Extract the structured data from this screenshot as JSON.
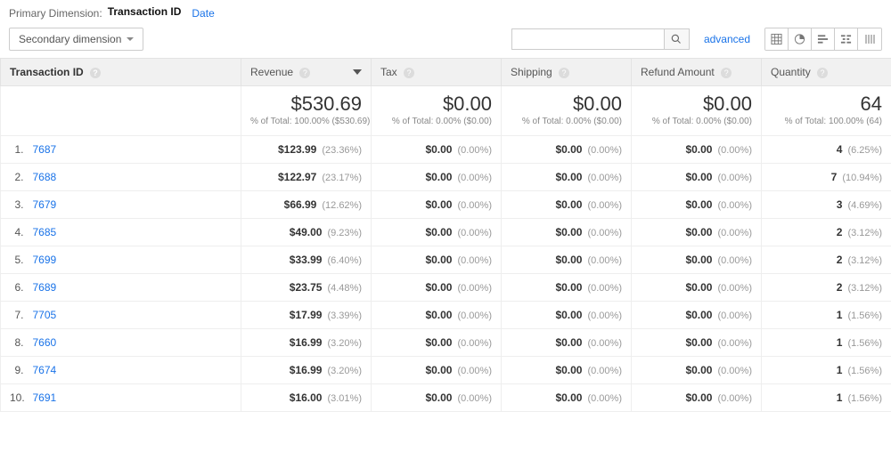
{
  "primary_dimension": {
    "label": "Primary Dimension:",
    "active": "Transaction ID",
    "other": "Date"
  },
  "secondary_dimension": {
    "label": "Secondary dimension"
  },
  "advanced_link": "advanced",
  "columns": {
    "transaction_id": "Transaction ID",
    "revenue": "Revenue",
    "tax": "Tax",
    "shipping": "Shipping",
    "refund": "Refund Amount",
    "quantity": "Quantity"
  },
  "totals": {
    "revenue_val": "$530.69",
    "revenue_sub": "% of Total: 100.00% ($530.69)",
    "tax_val": "$0.00",
    "tax_sub": "% of Total: 0.00% ($0.00)",
    "shipping_val": "$0.00",
    "shipping_sub": "% of Total: 0.00% ($0.00)",
    "refund_val": "$0.00",
    "refund_sub": "% of Total: 0.00% ($0.00)",
    "quantity_val": "64",
    "quantity_sub": "% of Total: 100.00% (64)"
  },
  "rows": [
    {
      "idx": "1.",
      "tid": "7687",
      "rev_v": "$123.99",
      "rev_p": "(23.36%)",
      "tax_v": "$0.00",
      "tax_p": "(0.00%)",
      "ship_v": "$0.00",
      "ship_p": "(0.00%)",
      "ref_v": "$0.00",
      "ref_p": "(0.00%)",
      "qty_v": "4",
      "qty_p": "(6.25%)"
    },
    {
      "idx": "2.",
      "tid": "7688",
      "rev_v": "$122.97",
      "rev_p": "(23.17%)",
      "tax_v": "$0.00",
      "tax_p": "(0.00%)",
      "ship_v": "$0.00",
      "ship_p": "(0.00%)",
      "ref_v": "$0.00",
      "ref_p": "(0.00%)",
      "qty_v": "7",
      "qty_p": "(10.94%)"
    },
    {
      "idx": "3.",
      "tid": "7679",
      "rev_v": "$66.99",
      "rev_p": "(12.62%)",
      "tax_v": "$0.00",
      "tax_p": "(0.00%)",
      "ship_v": "$0.00",
      "ship_p": "(0.00%)",
      "ref_v": "$0.00",
      "ref_p": "(0.00%)",
      "qty_v": "3",
      "qty_p": "(4.69%)"
    },
    {
      "idx": "4.",
      "tid": "7685",
      "rev_v": "$49.00",
      "rev_p": "(9.23%)",
      "tax_v": "$0.00",
      "tax_p": "(0.00%)",
      "ship_v": "$0.00",
      "ship_p": "(0.00%)",
      "ref_v": "$0.00",
      "ref_p": "(0.00%)",
      "qty_v": "2",
      "qty_p": "(3.12%)"
    },
    {
      "idx": "5.",
      "tid": "7699",
      "rev_v": "$33.99",
      "rev_p": "(6.40%)",
      "tax_v": "$0.00",
      "tax_p": "(0.00%)",
      "ship_v": "$0.00",
      "ship_p": "(0.00%)",
      "ref_v": "$0.00",
      "ref_p": "(0.00%)",
      "qty_v": "2",
      "qty_p": "(3.12%)"
    },
    {
      "idx": "6.",
      "tid": "7689",
      "rev_v": "$23.75",
      "rev_p": "(4.48%)",
      "tax_v": "$0.00",
      "tax_p": "(0.00%)",
      "ship_v": "$0.00",
      "ship_p": "(0.00%)",
      "ref_v": "$0.00",
      "ref_p": "(0.00%)",
      "qty_v": "2",
      "qty_p": "(3.12%)"
    },
    {
      "idx": "7.",
      "tid": "7705",
      "rev_v": "$17.99",
      "rev_p": "(3.39%)",
      "tax_v": "$0.00",
      "tax_p": "(0.00%)",
      "ship_v": "$0.00",
      "ship_p": "(0.00%)",
      "ref_v": "$0.00",
      "ref_p": "(0.00%)",
      "qty_v": "1",
      "qty_p": "(1.56%)"
    },
    {
      "idx": "8.",
      "tid": "7660",
      "rev_v": "$16.99",
      "rev_p": "(3.20%)",
      "tax_v": "$0.00",
      "tax_p": "(0.00%)",
      "ship_v": "$0.00",
      "ship_p": "(0.00%)",
      "ref_v": "$0.00",
      "ref_p": "(0.00%)",
      "qty_v": "1",
      "qty_p": "(1.56%)"
    },
    {
      "idx": "9.",
      "tid": "7674",
      "rev_v": "$16.99",
      "rev_p": "(3.20%)",
      "tax_v": "$0.00",
      "tax_p": "(0.00%)",
      "ship_v": "$0.00",
      "ship_p": "(0.00%)",
      "ref_v": "$0.00",
      "ref_p": "(0.00%)",
      "qty_v": "1",
      "qty_p": "(1.56%)"
    },
    {
      "idx": "10.",
      "tid": "7691",
      "rev_v": "$16.00",
      "rev_p": "(3.01%)",
      "tax_v": "$0.00",
      "tax_p": "(0.00%)",
      "ship_v": "$0.00",
      "ship_p": "(0.00%)",
      "ref_v": "$0.00",
      "ref_p": "(0.00%)",
      "qty_v": "1",
      "qty_p": "(1.56%)"
    }
  ]
}
